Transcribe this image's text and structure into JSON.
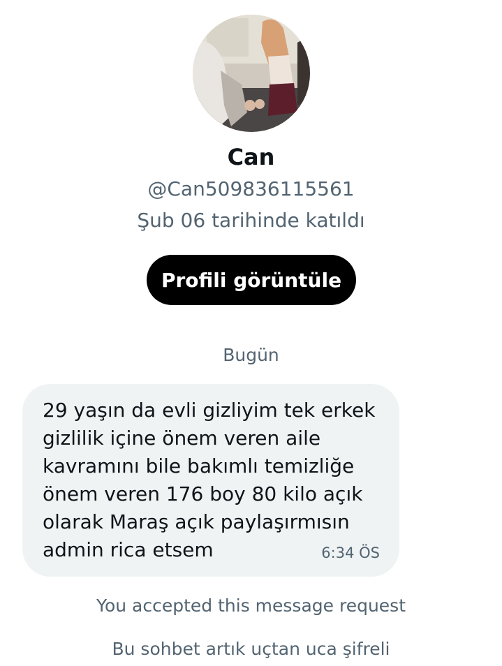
{
  "profile": {
    "name": "Can",
    "handle": "@Can509836115561",
    "joined": "Şub 06 tarihinde katıldı",
    "view_profile_label": "Profili görüntüle",
    "avatar_icon": "profile-photo"
  },
  "conversation": {
    "day_separator": "Bugün",
    "messages": [
      {
        "text": "29 yaşın da evli gizliyim tek erkek\ngizlilik içine önem veren aile\nkavramını bile bakımlı temizliğe\nönem veren 176 boy 80 kilo açık\nolarak Maraş  açık paylaşırmısın\nadmin rica etsem",
        "time": "6:34 ÖS"
      }
    ],
    "accepted_notice": "You accepted this message request",
    "encryption_notice": "Bu sohbet artık uçtan uca şifreli"
  },
  "colors": {
    "primary_text": "#0f1419",
    "secondary_text": "#536471",
    "bubble_bg": "#eff3f4",
    "button_bg": "#000000",
    "button_text": "#ffffff"
  }
}
